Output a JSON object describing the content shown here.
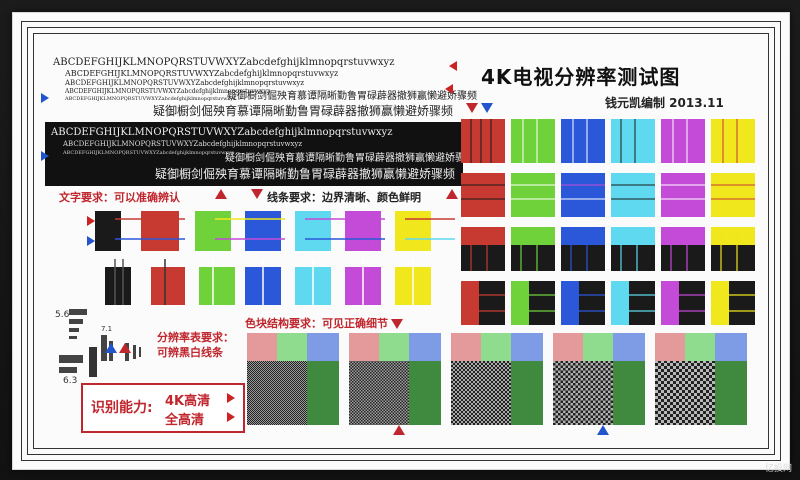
{
  "chart_title": "4K电视分辨率测试图",
  "author_line": "钱元凯编制   2013.11",
  "sample_text": {
    "latin1": "ABCDEFGHIJKLMNOPQRSTUVWXYZabcdefghijklmnopqrstuvwxyz",
    "cjk1": "疑御橱剑倔殃育慕谭隔晰勤鲁胃碌薜器撤狮赢懒避娇骤频",
    "latin_inv": "ABCDEFGHIJKLMNOPQRSTUVWXYZabcdefghijklmnopqrstuvwxyz",
    "cjk_inv": "疑御橱剑倔殃育慕谭隔晰勤鲁胃碌薜器撤狮赢懒避娇骤频"
  },
  "labels": {
    "text_requirement": "文字要求：可以准确辨认",
    "line_requirement": "线条要求：边界清晰、颜色鲜明",
    "resolution_requirement_1": "分辨率表要求：",
    "resolution_requirement_2": "可辨黑白线条",
    "color_block_requirement": "色块结构要求：可见正确细节",
    "recognition": "识别能力:",
    "res_4k": "4K高清",
    "res_fhd": "全高清"
  },
  "colors": {
    "red": "#c73a32",
    "green": "#6fd23a",
    "blue": "#2a58d8",
    "cyan": "#5fd9ef",
    "magenta": "#c44ad8",
    "yellow": "#f0e71c",
    "black": "#1a1a1a",
    "accent_red": "#c0262d",
    "accent_blue": "#2255cc"
  },
  "watermark": "亿投网"
}
